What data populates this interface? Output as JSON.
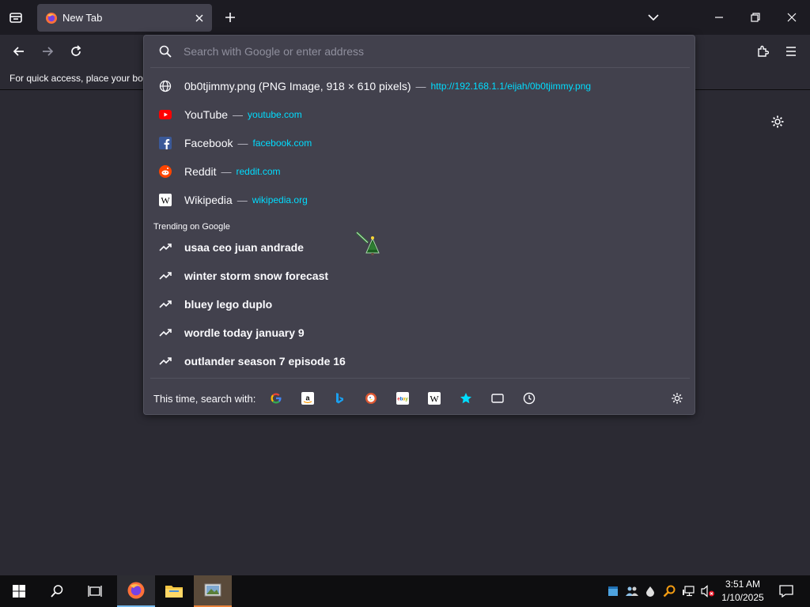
{
  "tab": {
    "title": "New Tab"
  },
  "bookmarks_bar": {
    "text": "For quick access, place your boo"
  },
  "urlbar": {
    "placeholder": "Search with Google or enter address",
    "results": [
      {
        "title": "0b0tjimmy.png (PNG Image, 918 × 610 pixels)",
        "url": "http://192.168.1.1/eijah/0b0tjimmy.png",
        "icon": "globe-icon"
      },
      {
        "title": "YouTube",
        "url": "youtube.com",
        "icon": "youtube-icon"
      },
      {
        "title": "Facebook",
        "url": "facebook.com",
        "icon": "facebook-icon"
      },
      {
        "title": "Reddit",
        "url": "reddit.com",
        "icon": "reddit-icon"
      },
      {
        "title": "Wikipedia",
        "url": "wikipedia.org",
        "icon": "wikipedia-icon"
      }
    ],
    "separator": "—",
    "trending_label": "Trending on Google",
    "trending": [
      "usaa ceo juan andrade",
      "winter storm snow forecast",
      "bluey lego duplo",
      "wordle today january 9",
      "outlander season 7 episode 16"
    ],
    "search_with_label": "This time, search with:",
    "engines": [
      "google",
      "amazon",
      "bing",
      "duckduckgo",
      "ebay",
      "wikipedia",
      "bookmarks",
      "tabs",
      "history"
    ]
  },
  "taskbar": {
    "time": "3:51 AM",
    "date": "1/10/2025"
  },
  "colors": {
    "accent_url": "#00ddff",
    "panel": "#42414d",
    "background": "#2b2a33",
    "tabstrip": "#1c1b22"
  }
}
